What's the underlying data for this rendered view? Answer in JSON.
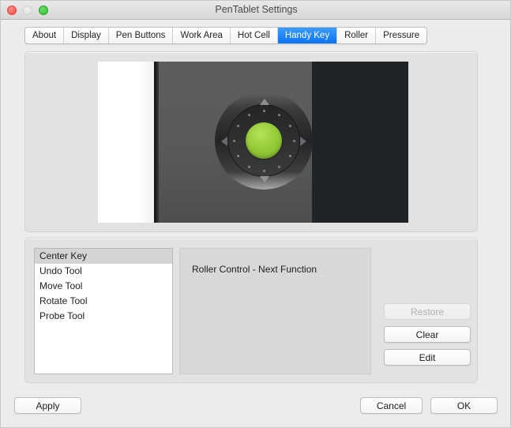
{
  "window": {
    "title": "PenTablet Settings",
    "traffic_lights": [
      {
        "name": "close",
        "color": "#f05249"
      },
      {
        "name": "minimize",
        "color": "#dedede"
      },
      {
        "name": "maximize",
        "color": "#2dc22c"
      }
    ]
  },
  "tabs": [
    {
      "label": "About",
      "selected": false
    },
    {
      "label": "Display",
      "selected": false
    },
    {
      "label": "Pen Buttons",
      "selected": false
    },
    {
      "label": "Work Area",
      "selected": false
    },
    {
      "label": "Hot Cell",
      "selected": false
    },
    {
      "label": "Handy Key",
      "selected": true
    },
    {
      "label": "Roller",
      "selected": false
    },
    {
      "label": "Pressure",
      "selected": false
    }
  ],
  "accent_color": "#0a73ef",
  "preview": {
    "device_name": "pen-tablet-handy-key-wheel",
    "center_button_color": "#9ace3c",
    "led_color": "#ffffff"
  },
  "key_list": {
    "items": [
      {
        "label": "Center Key",
        "selected": true
      },
      {
        "label": "Undo Tool",
        "selected": false
      },
      {
        "label": "Move Tool",
        "selected": false
      },
      {
        "label": "Rotate Tool",
        "selected": false
      },
      {
        "label": "Probe Tool",
        "selected": false
      }
    ]
  },
  "description": {
    "text": "Roller Control - Next Function"
  },
  "side_buttons": [
    {
      "label": "Restore",
      "enabled": false
    },
    {
      "label": "Clear",
      "enabled": true
    },
    {
      "label": "Edit",
      "enabled": true
    }
  ],
  "footer": {
    "apply_label": "Apply",
    "cancel_label": "Cancel",
    "ok_label": "OK"
  }
}
